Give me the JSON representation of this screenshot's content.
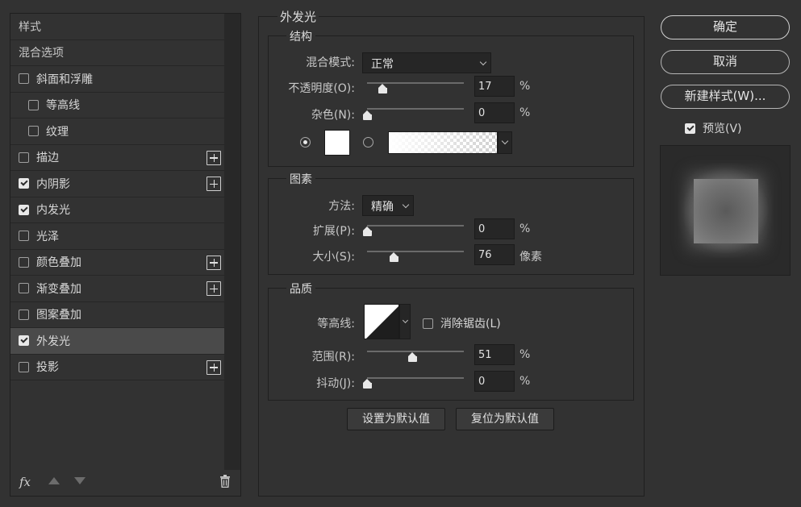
{
  "styles_panel": {
    "header": "样式",
    "blending_options": "混合选项",
    "items": [
      {
        "label": "斜面和浮雕",
        "checked": false,
        "indent": false,
        "plus": false
      },
      {
        "label": "等高线",
        "checked": false,
        "indent": true,
        "plus": false
      },
      {
        "label": "纹理",
        "checked": false,
        "indent": true,
        "plus": false
      },
      {
        "label": "描边",
        "checked": false,
        "indent": false,
        "plus": true
      },
      {
        "label": "内阴影",
        "checked": true,
        "indent": false,
        "plus": true
      },
      {
        "label": "内发光",
        "checked": true,
        "indent": false,
        "plus": false
      },
      {
        "label": "光泽",
        "checked": false,
        "indent": false,
        "plus": false
      },
      {
        "label": "颜色叠加",
        "checked": false,
        "indent": false,
        "plus": true
      },
      {
        "label": "渐变叠加",
        "checked": false,
        "indent": false,
        "plus": true
      },
      {
        "label": "图案叠加",
        "checked": false,
        "indent": false,
        "plus": false
      },
      {
        "label": "外发光",
        "checked": true,
        "indent": false,
        "plus": false,
        "selected": true
      },
      {
        "label": "投影",
        "checked": false,
        "indent": false,
        "plus": true
      }
    ],
    "footer": {
      "fx_label": "fx",
      "icons": [
        "fx-icon",
        "arrow-up-icon",
        "arrow-down-icon",
        "trash-icon"
      ]
    }
  },
  "outer_glow": {
    "title": "外发光",
    "structure": {
      "title": "结构",
      "blend_mode_label": "混合模式:",
      "blend_mode_value": "正常",
      "opacity_label": "不透明度(O):",
      "opacity_value": "17",
      "opacity_unit": "%",
      "opacity_fraction": 0.17,
      "noise_label": "杂色(N):",
      "noise_value": "0",
      "noise_unit": "%",
      "noise_fraction": 0.0,
      "color_swatch": "#ffffff",
      "solid_color_selected": true
    },
    "elements": {
      "title": "图素",
      "technique_label": "方法:",
      "technique_value": "精确",
      "spread_label": "扩展(P):",
      "spread_value": "0",
      "spread_unit": "%",
      "spread_fraction": 0.0,
      "size_label": "大小(S):",
      "size_value": "76",
      "size_unit": "像素",
      "size_fraction": 0.3
    },
    "quality": {
      "title": "品质",
      "contour_label": "等高线:",
      "anti_alias_label": "消除锯齿(L)",
      "anti_alias_checked": false,
      "range_label": "范围(R):",
      "range_value": "51",
      "range_unit": "%",
      "range_fraction": 0.51,
      "jitter_label": "抖动(J):",
      "jitter_value": "0",
      "jitter_unit": "%",
      "jitter_fraction": 0.0
    },
    "set_default": "设置为默认值",
    "reset_default": "复位为默认值"
  },
  "actions": {
    "ok": "确定",
    "cancel": "取消",
    "new_style": "新建样式(W)...",
    "preview_label": "预览(V)",
    "preview_checked": true
  },
  "colors": {
    "background": "#323232",
    "field": "#262626",
    "selected_row": "#4a4a4a"
  }
}
